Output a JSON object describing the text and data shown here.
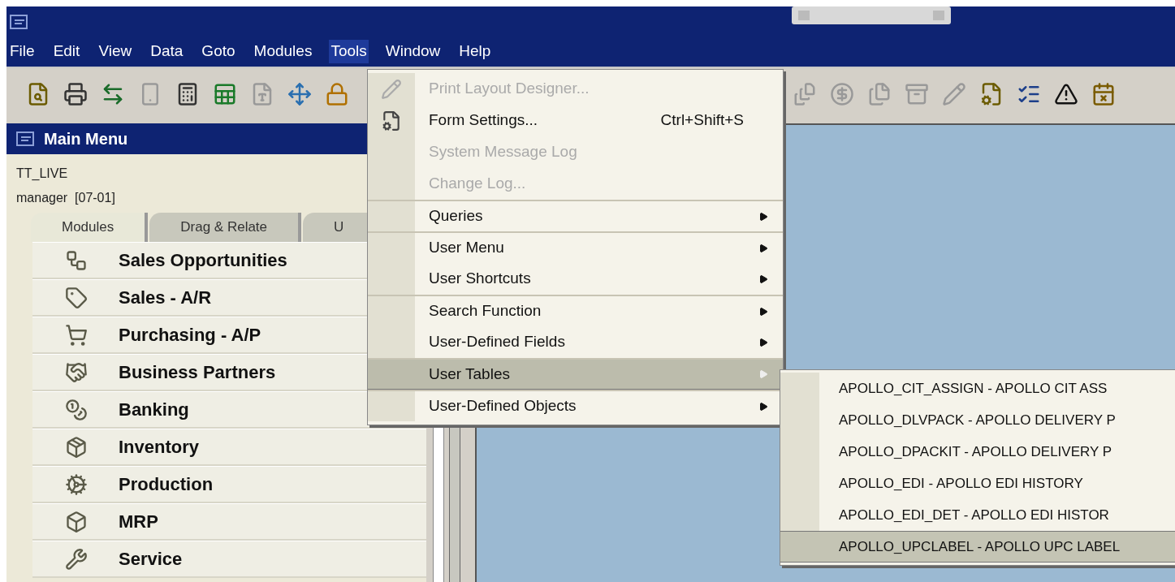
{
  "menubar": [
    {
      "label": "File",
      "selected": false
    },
    {
      "label": "Edit",
      "selected": false
    },
    {
      "label": "View",
      "selected": false
    },
    {
      "label": "Data",
      "selected": false
    },
    {
      "label": "Goto",
      "selected": false
    },
    {
      "label": "Modules",
      "selected": false
    },
    {
      "label": "Tools",
      "selected": true
    },
    {
      "label": "Window",
      "selected": false
    },
    {
      "label": "Help",
      "selected": false
    }
  ],
  "sidebar": {
    "title": "Main Menu",
    "company": "TT_LIVE",
    "user": "manager  [07-01]",
    "tabs": [
      {
        "label": "Modules",
        "selected": true
      },
      {
        "label": "Drag & Relate",
        "selected": false
      },
      {
        "label": "U",
        "selected": false
      }
    ],
    "modules": [
      {
        "label": "Sales Opportunities",
        "kind": "opportunities"
      },
      {
        "label": "Sales - A/R",
        "kind": "sales"
      },
      {
        "label": "Purchasing - A/P",
        "kind": "purchasing"
      },
      {
        "label": "Business Partners",
        "kind": "partners"
      },
      {
        "label": "Banking",
        "kind": "banking"
      },
      {
        "label": "Inventory",
        "kind": "inventory"
      },
      {
        "label": "Production",
        "kind": "production"
      },
      {
        "label": "MRP",
        "kind": "mrp"
      },
      {
        "label": "Service",
        "kind": "service"
      }
    ]
  },
  "tools_menu": {
    "items": [
      {
        "label": "Print Layout Designer...",
        "disabled": true,
        "submenu": false,
        "selected": false,
        "separator_before": false
      },
      {
        "label": "Form Settings...",
        "shortcut": "Ctrl+Shift+S",
        "disabled": false,
        "submenu": false,
        "selected": false,
        "separator_before": false
      },
      {
        "label": "System Message Log",
        "disabled": true,
        "submenu": false,
        "selected": false,
        "separator_before": false
      },
      {
        "label": "Change Log...",
        "disabled": true,
        "submenu": false,
        "selected": false,
        "separator_before": false
      },
      {
        "label": "Queries",
        "disabled": false,
        "submenu": true,
        "selected": false,
        "separator_before": true
      },
      {
        "label": "User Menu",
        "disabled": false,
        "submenu": true,
        "selected": false,
        "separator_before": true
      },
      {
        "label": "User Shortcuts",
        "disabled": false,
        "submenu": true,
        "selected": false,
        "separator_before": false
      },
      {
        "label": "Search Function",
        "disabled": false,
        "submenu": true,
        "selected": false,
        "separator_before": true
      },
      {
        "label": "User-Defined Fields",
        "disabled": false,
        "submenu": true,
        "selected": false,
        "separator_before": false
      },
      {
        "label": "User Tables",
        "disabled": false,
        "submenu": true,
        "selected": true,
        "separator_before": true
      },
      {
        "label": "User-Defined Objects",
        "disabled": false,
        "submenu": true,
        "selected": false,
        "separator_before": true
      }
    ]
  },
  "user_tables_submenu": {
    "items": [
      {
        "label": "APOLLO_CIT_ASSIGN - APOLLO CIT ASS",
        "selected": false
      },
      {
        "label": "APOLLO_DLVPACK - APOLLO DELIVERY P",
        "selected": false
      },
      {
        "label": "APOLLO_DPACKIT - APOLLO DELIVERY P",
        "selected": false
      },
      {
        "label": "APOLLO_EDI - APOLLO EDI HISTORY",
        "selected": false
      },
      {
        "label": "APOLLO_EDI_DET - APOLLO EDI HISTOR",
        "selected": false
      },
      {
        "label": "APOLLO_UPCLABEL - APOLLO UPC LABEL",
        "selected": true
      }
    ]
  }
}
